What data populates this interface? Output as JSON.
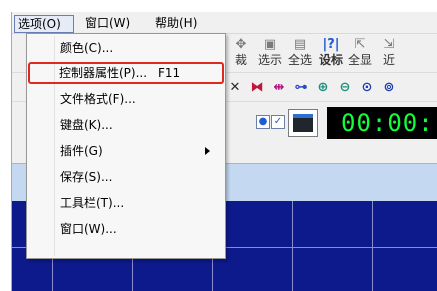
{
  "menubar": {
    "options": "选项(O)",
    "window": "窗口(W)",
    "help": "帮助(H)"
  },
  "toolbar": {
    "buttons": [
      {
        "label": "裁",
        "icon": "move-icon"
      },
      {
        "label": "选示",
        "icon": "select-show-icon"
      },
      {
        "label": "全选",
        "icon": "select-all-icon"
      },
      {
        "label": "设标",
        "icon": "set-marker-icon",
        "active": true
      },
      {
        "label": "全显",
        "icon": "show-all-icon"
      },
      {
        "label": "近",
        "icon": "near-icon"
      }
    ],
    "time_display": "00:00:"
  },
  "dropdown": {
    "items": [
      {
        "label": "颜色(C)...",
        "shortcut": ""
      },
      {
        "label": "控制器属性(P)...",
        "shortcut": "F11",
        "highlighted": true
      },
      {
        "label": "文件格式(F)...",
        "shortcut": ""
      },
      {
        "label": "键盘(K)...",
        "shortcut": ""
      },
      {
        "label": "插件(G)",
        "shortcut": "",
        "submenu": true
      },
      {
        "label": "保存(S)...",
        "shortcut": ""
      },
      {
        "label": "工具栏(T)...",
        "shortcut": ""
      },
      {
        "label": "窗口(W)...",
        "shortcut": ""
      }
    ]
  },
  "colors": {
    "highlight_border": "#e0281f",
    "time_text": "#11ff3a",
    "grid_background": "#0d1a8c",
    "subbar_background": "#c4d9f1"
  }
}
